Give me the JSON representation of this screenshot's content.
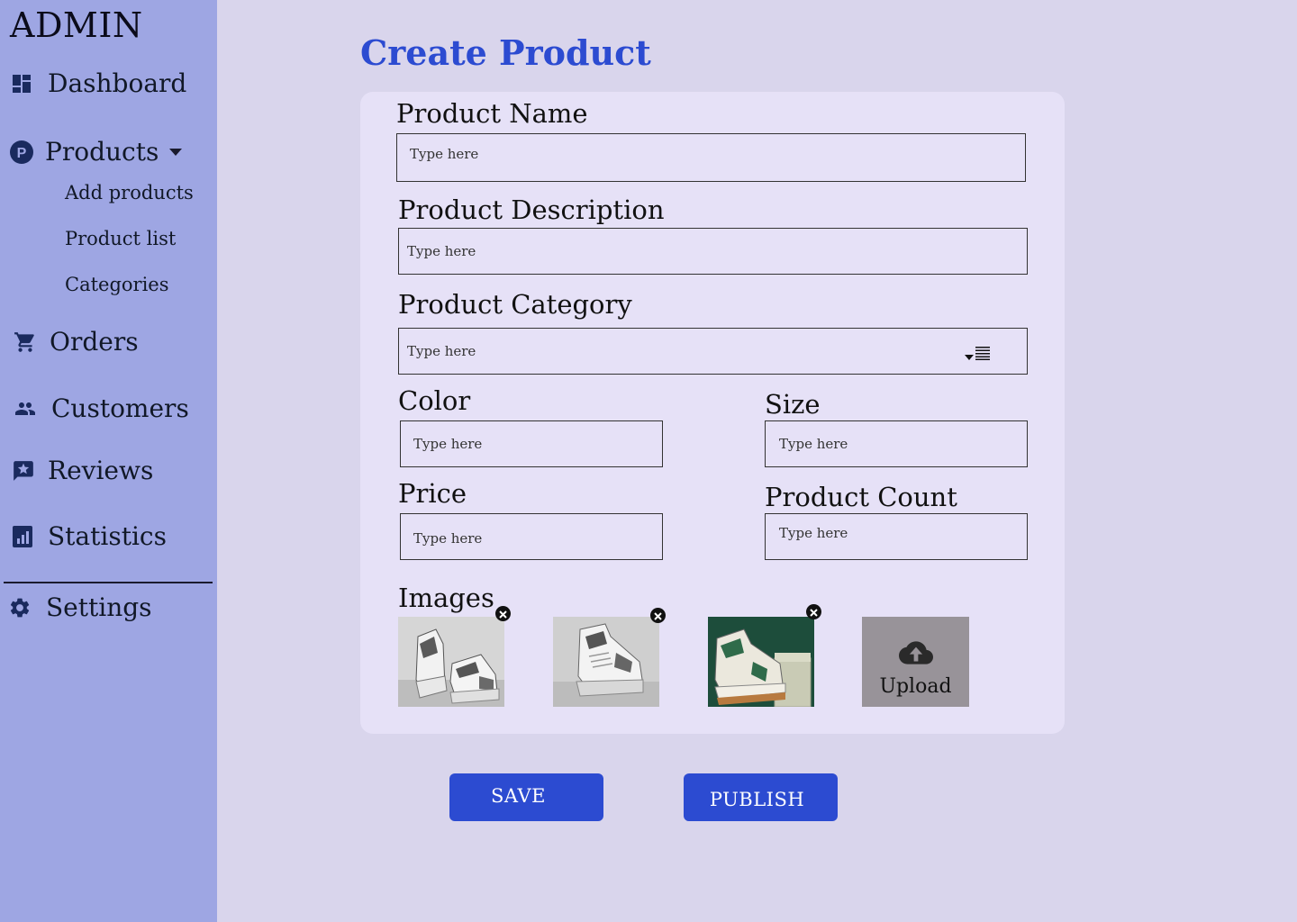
{
  "sidebar": {
    "brand": "ADMIN",
    "items": [
      {
        "label": "Dashboard",
        "icon": "dashboard-icon"
      },
      {
        "label": "Products",
        "icon": "products-p-icon",
        "expanded": true,
        "subitems": [
          {
            "label": "Add products"
          },
          {
            "label": "Product list"
          },
          {
            "label": "Categories"
          }
        ]
      },
      {
        "label": "Orders",
        "icon": "cart-icon"
      },
      {
        "label": "Customers",
        "icon": "people-icon"
      },
      {
        "label": "Reviews",
        "icon": "review-star-icon"
      },
      {
        "label": "Statistics",
        "icon": "statistics-icon"
      },
      {
        "label": "Settings",
        "icon": "gear-icon"
      }
    ]
  },
  "main": {
    "title": "Create Product",
    "form": {
      "product_name": {
        "label": "Product Name",
        "placeholder": "Type here"
      },
      "product_description": {
        "label": "Product Description",
        "placeholder": "Type here"
      },
      "product_category": {
        "label": "Product Category",
        "placeholder": "Type here"
      },
      "color": {
        "label": "Color",
        "placeholder": "Type here"
      },
      "size": {
        "label": "Size",
        "placeholder": "Type here"
      },
      "price": {
        "label": "Price",
        "placeholder": "Type here"
      },
      "product_count": {
        "label": "Product Count",
        "placeholder": "Type here"
      },
      "images": {
        "label": "Images",
        "upload_label": "Upload"
      }
    },
    "actions": {
      "save_label": "SAVE",
      "publish_label": "PUBLISH"
    }
  },
  "colors": {
    "accent": "#2c4bd1",
    "sidebar_bg": "#9ea6e3",
    "page_bg": "#d9d5ec",
    "card_bg": "#e6e1f7"
  }
}
